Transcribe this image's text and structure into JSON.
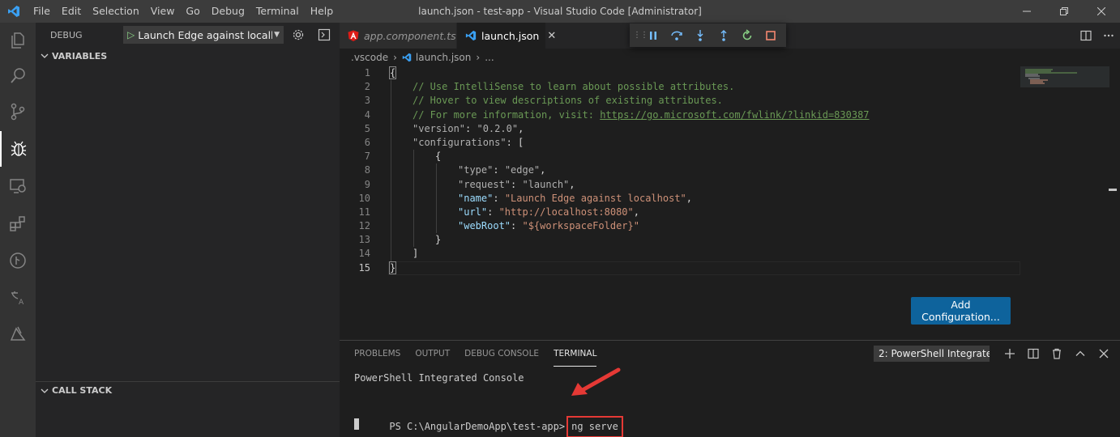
{
  "window": {
    "title": "launch.json - test-app - Visual Studio Code [Administrator]"
  },
  "menu": [
    "File",
    "Edit",
    "Selection",
    "View",
    "Go",
    "Debug",
    "Terminal",
    "Help"
  ],
  "sidebar": {
    "title": "DEBUG",
    "launch_config": "Launch Edge against localhost",
    "variables_header": "VARIABLES",
    "callstack_header": "CALL STACK"
  },
  "tabs": [
    {
      "label": "app.component.ts",
      "active": false,
      "icon": "angular-icon"
    },
    {
      "label": "launch.json",
      "active": true,
      "icon": "vscode-icon"
    }
  ],
  "breadcrumb": [
    ".vscode",
    "launch.json",
    "..."
  ],
  "code_lines": [
    {
      "n": "1"
    },
    {
      "n": "2"
    },
    {
      "n": "3"
    },
    {
      "n": "4"
    },
    {
      "n": "5"
    },
    {
      "n": "6"
    },
    {
      "n": "7"
    },
    {
      "n": "8"
    },
    {
      "n": "9"
    },
    {
      "n": "10"
    },
    {
      "n": "11"
    },
    {
      "n": "12"
    },
    {
      "n": "13"
    },
    {
      "n": "14"
    },
    {
      "n": "15"
    }
  ],
  "code": {
    "l1": "{",
    "l2": "// Use IntelliSense to learn about possible attributes.",
    "l3": "// Hover to view descriptions of existing attributes.",
    "l4_pre": "// For more information, visit: ",
    "l4_link": "https://go.microsoft.com/fwlink/?linkid=830387",
    "l5_key": "\"version\"",
    "l5_val": "\"0.2.0\"",
    "l6_key": "\"configurations\"",
    "l6_rest": ": [",
    "l7": "{",
    "l8_key": "\"type\"",
    "l8_val": "\"edge\"",
    "l9_key": "\"request\"",
    "l9_val": "\"launch\"",
    "l10_key": "\"name\"",
    "l10_val": "\"Launch Edge against localhost\"",
    "l11_key": "\"url\"",
    "l11_val": "\"http://localhost:8080\"",
    "l12_key": "\"webRoot\"",
    "l12_val": "\"${workspaceFolder}\"",
    "l13": "}",
    "l14": "]",
    "l15": "}"
  },
  "add_configuration_label": "Add Configuration...",
  "panel": {
    "tabs": [
      "PROBLEMS",
      "OUTPUT",
      "DEBUG CONSOLE",
      "TERMINAL"
    ],
    "active_tab": "TERMINAL",
    "terminal_select": "2: PowerShell Integrate",
    "terminal_title": "PowerShell Integrated Console",
    "prompt": "PS C:\\AngularDemoApp\\test-app>",
    "command": "ng serve"
  },
  "colors": {
    "accent": "#0e639c",
    "annotation": "#e53935",
    "status_green": "#89d185"
  }
}
